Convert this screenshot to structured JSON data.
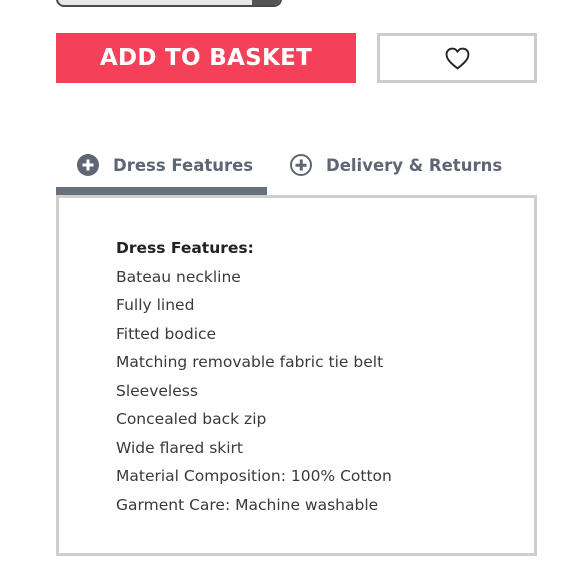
{
  "actions": {
    "add_to_basket_label": "ADD TO BASKET",
    "wishlist_icon": "heart-icon"
  },
  "tabs": [
    {
      "label": "Dress Features",
      "icon": "plus-circle-filled-icon",
      "active": true
    },
    {
      "label": "Delivery & Returns",
      "icon": "plus-circle-outline-icon",
      "active": false
    }
  ],
  "features": {
    "heading": "Dress Features:",
    "items": [
      "Bateau neckline",
      "Fully lined",
      "Fitted bodice",
      "Matching removable fabric tie belt",
      "Sleeveless",
      "Concealed back zip",
      "Wide flared skirt",
      "Material Composition: 100% Cotton",
      "Garment Care: Machine washable"
    ]
  },
  "colors": {
    "add_button": "#f5405a",
    "tab_text": "#5f6673",
    "active_underline": "#68707c",
    "panel_border": "#cfcfcf"
  }
}
